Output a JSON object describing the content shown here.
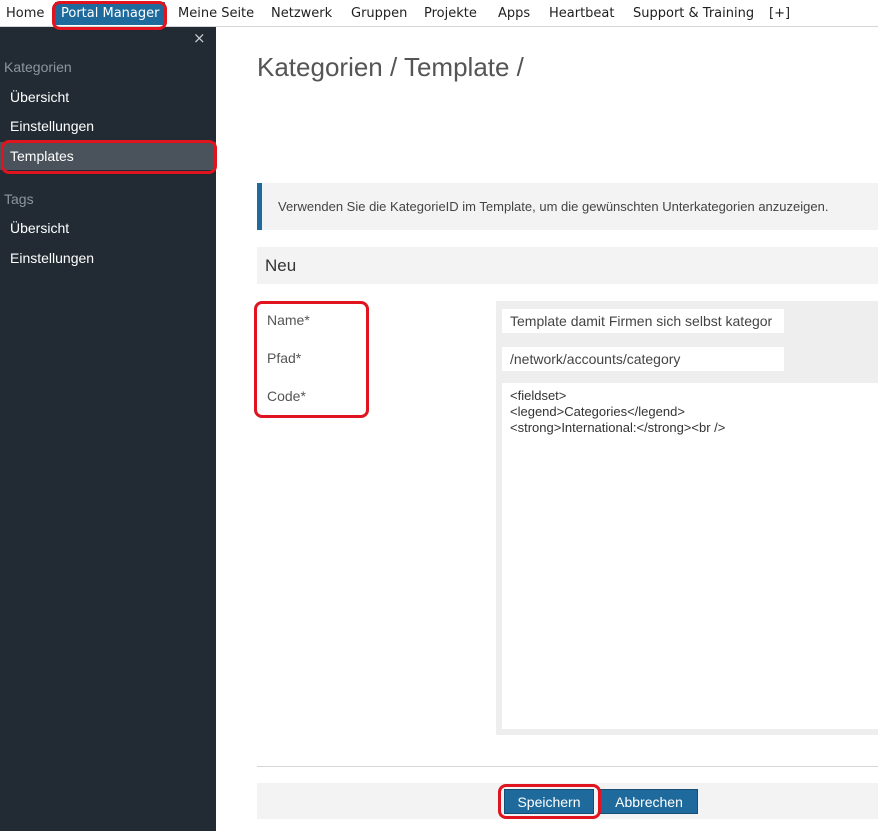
{
  "topnav": {
    "items": [
      "Home",
      "Portal Manager",
      "Meine Seite",
      "Netzwerk",
      "Gruppen",
      "Projekte",
      "Apps",
      "Heartbeat",
      "Support & Training",
      "[+]"
    ]
  },
  "sidebar": {
    "close_icon": "×",
    "kategorien_title": "Kategorien",
    "kategorien_items": [
      "Übersicht",
      "Einstellungen",
      "Templates"
    ],
    "tags_title": "Tags",
    "tags_items": [
      "Übersicht",
      "Einstellungen"
    ]
  },
  "main": {
    "title": "Kategorien / Template /",
    "info": "Verwenden Sie die KategorieID im Template, um die gewünschten Unterkategorien anzuzeigen.",
    "form_header": "Neu",
    "labels": {
      "name": "Name*",
      "path": "Pfad*",
      "code": "Code*"
    },
    "values": {
      "name": "Template damit Firmen sich selbst kategor",
      "path": "/network/accounts/category",
      "code": "<fieldset>\n<legend>Categories</legend>\n<strong>International:</strong><br />"
    },
    "buttons": {
      "save": "Speichern",
      "cancel": "Abbrechen"
    }
  },
  "colors": {
    "accent": "#1f6a9c",
    "sidebar_bg": "#222b33",
    "highlight": "#e0141e"
  }
}
